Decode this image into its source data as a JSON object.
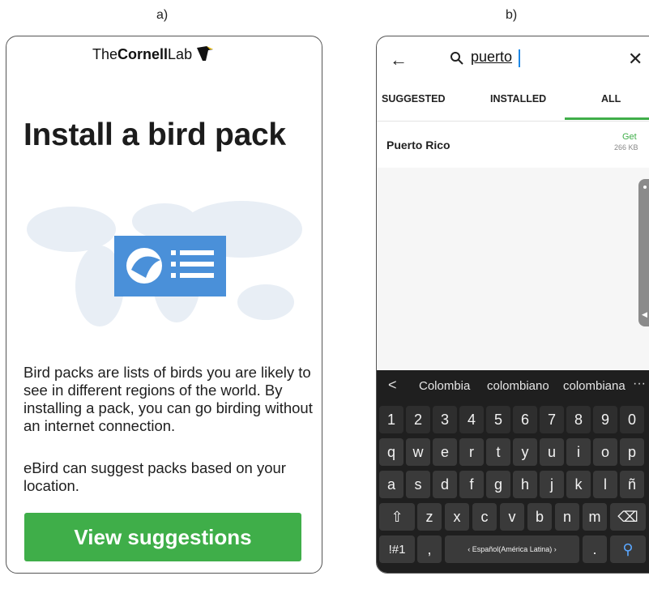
{
  "labels": {
    "a": "a)",
    "b": "b)"
  },
  "panel_a": {
    "logo_the": "The",
    "logo_cornell": "Cornell",
    "logo_lab": "Lab",
    "title": "Install a bird pack",
    "description": "Bird packs are lists of birds you are likely to see in different regions of the world. By installing a pack, you can go birding without an internet connection.",
    "suggest_note": "eBird can suggest packs based on your location.",
    "button_label": "View suggestions",
    "colors": {
      "accent_green": "#3fae49",
      "illustration_blue": "#4a90d9"
    }
  },
  "panel_b": {
    "search": {
      "value": "puerto",
      "back_icon": "arrow-left-icon",
      "clear_icon": "close-icon"
    },
    "tabs": [
      {
        "label": "SUGGESTED",
        "selected": false
      },
      {
        "label": "INSTALLED",
        "selected": false
      },
      {
        "label": "ALL",
        "selected": true
      }
    ],
    "results": [
      {
        "name": "Puerto Rico",
        "action": "Get",
        "size": "266 KB"
      }
    ],
    "keyboard": {
      "suggestions": [
        "Colombia",
        "colombiano",
        "colombiana"
      ],
      "more": "···",
      "back": "<",
      "number_row": [
        "1",
        "2",
        "3",
        "4",
        "5",
        "6",
        "7",
        "8",
        "9",
        "0"
      ],
      "row1": [
        "q",
        "w",
        "e",
        "r",
        "t",
        "y",
        "u",
        "i",
        "o",
        "p"
      ],
      "row2": [
        "a",
        "s",
        "d",
        "f",
        "g",
        "h",
        "j",
        "k",
        "l",
        "ñ"
      ],
      "row3": [
        "z",
        "x",
        "c",
        "v",
        "b",
        "n",
        "m"
      ],
      "shift": "⇧",
      "backspace": "⌫",
      "symbols": "!#1",
      "comma": ",",
      "space_label": "‹  Español(América Latina)  ›",
      "period": ".",
      "search_key": "⚲"
    }
  }
}
